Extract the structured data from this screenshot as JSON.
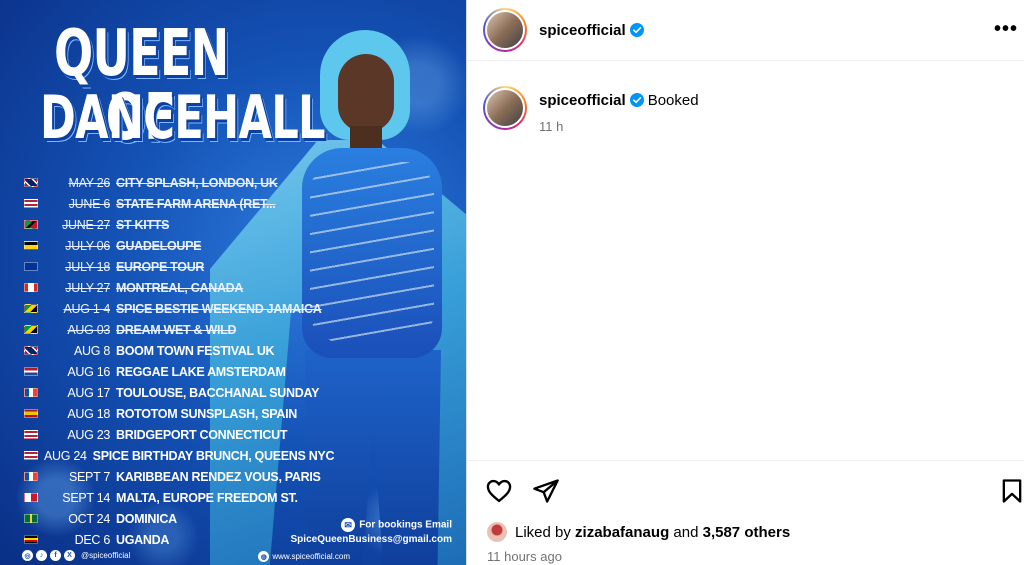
{
  "poster": {
    "title_line1": "QUEEN OF",
    "title_line2": "DANCEHALL",
    "schedule": [
      {
        "date": "MAY 26",
        "venue": "CITY SPLASH, LONDON, UK",
        "past": true,
        "flag": "uk"
      },
      {
        "date": "JUNE 6",
        "venue": "STATE FARM ARENA (RET...",
        "past": true,
        "flag": "us"
      },
      {
        "date": "JUNE 27",
        "venue": "ST KITTS",
        "past": true,
        "flag": "kn"
      },
      {
        "date": "JULY 06",
        "venue": "GUADELOUPE",
        "past": true,
        "flag": "gp"
      },
      {
        "date": "JULY 18",
        "venue": "EUROPE TOUR",
        "past": true,
        "flag": "eu"
      },
      {
        "date": "JULY 27",
        "venue": "MONTREAL, CANADA",
        "past": true,
        "flag": "ca"
      },
      {
        "date": "AUG 1-4",
        "venue": "SPICE BESTIE WEEKEND JAMAICA",
        "past": true,
        "flag": "jm"
      },
      {
        "date": "AUG 03",
        "venue": "DREAM WET & WILD",
        "past": true,
        "flag": "jm"
      },
      {
        "date": "AUG 8",
        "venue": "BOOM TOWN FESTIVAL UK",
        "past": false,
        "flag": "uk"
      },
      {
        "date": "AUG 16",
        "venue": "REGGAE LAKE AMSTERDAM",
        "past": false,
        "flag": "nl"
      },
      {
        "date": "AUG 17",
        "venue": "TOULOUSE, BACCHANAL SUNDAY",
        "past": false,
        "flag": "fr"
      },
      {
        "date": "AUG 18",
        "venue": "ROTOTOM SUNSPLASH, SPAIN",
        "past": false,
        "flag": "es"
      },
      {
        "date": "AUG 23",
        "venue": "BRIDGEPORT CONNECTICUT",
        "past": false,
        "flag": "us"
      },
      {
        "date": "AUG 24",
        "venue": "SPICE BIRTHDAY BRUNCH, QUEENS NYC",
        "past": false,
        "flag": "us"
      },
      {
        "date": "SEPT 7",
        "venue": "KARIBBEAN RENDEZ VOUS, PARIS",
        "past": false,
        "flag": "fr"
      },
      {
        "date": "SEPT 14",
        "venue": "MALTA, EUROPE FREEDOM ST.",
        "past": false,
        "flag": "mt"
      },
      {
        "date": "OCT 24",
        "venue": "DOMINICA",
        "past": false,
        "flag": "dm"
      },
      {
        "date": "DEC 6",
        "venue": "UGANDA",
        "past": false,
        "flag": "ug"
      }
    ],
    "booking_label": "For bookings Email",
    "booking_email": "SpiceQueenBusiness@gmail.com",
    "social_handle": "@spiceofficial",
    "website": "www.spiceofficial.com",
    "flag_colors": {
      "uk": "linear-gradient(45deg,#c8102e 0 20%,#fff 20% 30%,#012169 30% 70%,#fff 70% 80%,#c8102e 80%)",
      "us": "repeating-linear-gradient(180deg,#b22234 0 2px,#fff 2px 4px)",
      "kn": "linear-gradient(135deg,#009e49 0 40%,#000 40% 60%,#ce1126 60%)",
      "gp": "linear-gradient(180deg,#000 0 40%,#fcd116 40%)",
      "eu": "#003399",
      "ca": "linear-gradient(90deg,#d52b1e 0 25%,#fff 25% 75%,#d52b1e 75%)",
      "jm": "linear-gradient(135deg,#009b3a 0 35%,#fed100 35% 65%,#000 65%)",
      "nl": "linear-gradient(180deg,#ae1c28 0 33%,#fff 33% 66%,#21468b 66%)",
      "fr": "linear-gradient(90deg,#0055a4 0 33%,#fff 33% 66%,#ef4135 66%)",
      "es": "linear-gradient(180deg,#aa151b 0 25%,#f1bf00 25% 75%,#aa151b 75%)",
      "mt": "linear-gradient(90deg,#fff 0 50%,#cf142b 50%)",
      "dm": "linear-gradient(90deg,#006b3f 0 40%,#fcd116 40% 60%,#006b3f 60%)",
      "ug": "repeating-linear-gradient(180deg,#000 0 2px,#fcdc04 2px 4px,#d90000 4px 6px)"
    }
  },
  "post": {
    "username": "spiceofficial",
    "more_icon": "more-horizontal-icon",
    "caption": "Booked",
    "posted_relative": "11 h",
    "liked_by_label": "Liked by",
    "liked_by_user": "zizabafanaug",
    "and_label": "and",
    "others_count": "3,587 others",
    "time_ago": "11 hours ago",
    "icons": {
      "like": "heart-icon",
      "share": "send-icon",
      "save": "bookmark-icon"
    },
    "verified_color": "#0095f6"
  }
}
